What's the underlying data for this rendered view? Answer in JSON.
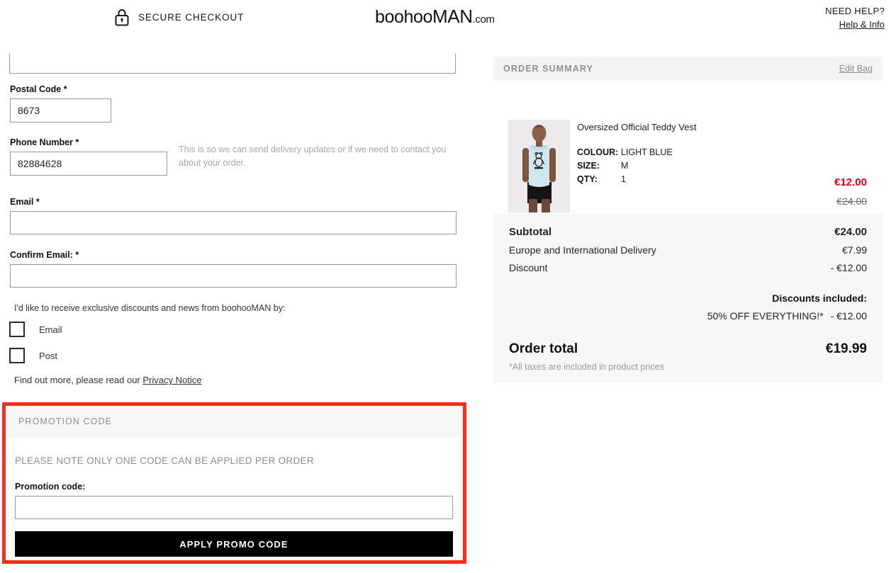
{
  "header": {
    "secure_text": "SECURE CHECKOUT",
    "lock_icon": "lock-icon",
    "logo_part1": "boohoo",
    "logo_part2": "MAN",
    "logo_part3": ".com",
    "need_help": "NEED HELP?",
    "help_link": "Help & Info"
  },
  "form": {
    "postal_label": "Postal Code *",
    "postal_value": "8673",
    "phone_label": "Phone Number *",
    "phone_value": "82884628",
    "phone_hint": "This is so we can send delivery updates or if we need to contact you about your order.",
    "email_label": "Email *",
    "email_value": "",
    "confirm_label": "Confirm Email: *",
    "confirm_value": "",
    "optin_text": "I'd like to receive exclusive discounts and news from boohooMAN by:",
    "optin_email": "Email",
    "optin_post": "Post",
    "privacy_prefix": "Find out more, please read our ",
    "privacy_link": "Privacy Notice"
  },
  "promotion": {
    "header": "PROMOTION CODE",
    "note": "PLEASE NOTE ONLY ONE CODE CAN BE APPLIED PER ORDER",
    "field_label": "Promotion code:",
    "input_value": "",
    "apply_button": "APPLY PROMO CODE",
    "highlight_color": "#fb2b1d"
  },
  "summary": {
    "header": "ORDER SUMMARY",
    "edit_bag": "Edit Bag",
    "product": {
      "name": "Oversized Official Teddy Vest",
      "colour_key": "COLOUR:",
      "colour_val": "LIGHT BLUE",
      "size_key": "SIZE:",
      "size_val": "M",
      "qty_key": "QTY:",
      "qty_val": "1",
      "price_now": "€12.00",
      "price_was": "€24.00",
      "price_now_color": "#d0021b"
    },
    "totals": {
      "subtotal_label": "Subtotal",
      "subtotal_value": "€24.00",
      "delivery_label": "Europe and International Delivery",
      "delivery_value": "€7.99",
      "discount_label": "Discount",
      "discount_value": "- €12.00",
      "discounts_included_title": "Discounts included:",
      "discount_name": "50% OFF EVERYTHING!*",
      "discount_amount": "- €12.00",
      "order_total_label": "Order total",
      "order_total_value": "€19.99",
      "tax_note": "*All taxes are included in product prices"
    }
  }
}
